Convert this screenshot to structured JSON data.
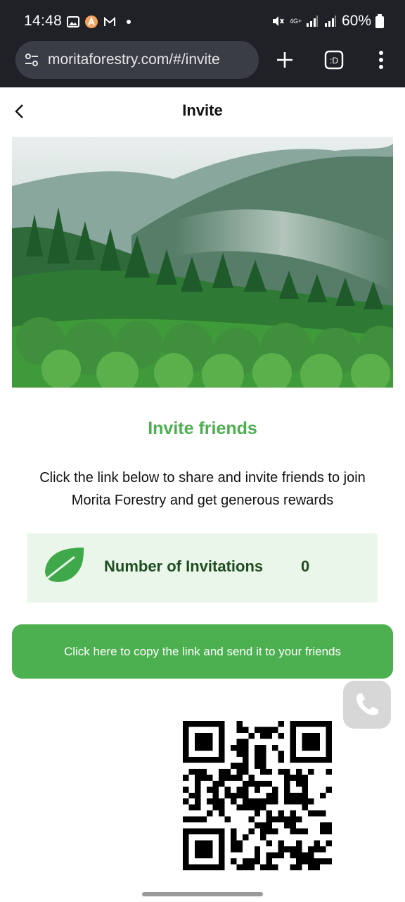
{
  "status_bar": {
    "time": "14:48",
    "battery": "60%",
    "network": "4G+"
  },
  "browser": {
    "url": "moritaforestry.com/#/invite",
    "tab_icon_text": ":D"
  },
  "header": {
    "title": "Invite"
  },
  "hero": {
    "subject": "misty forest mountains"
  },
  "invite": {
    "heading": "Invite friends",
    "description": "Click the link below to share and invite friends to join Morita Forestry and get generous rewards",
    "count_label": "Number of Invitations",
    "count_value": "0",
    "copy_button": "Click here to copy the link and send it to your friends"
  },
  "colors": {
    "accent_green": "#4caf50",
    "card_bg": "#eaf6ea",
    "dark_green_text": "#1f4d1f",
    "chrome_dark": "#1f2127"
  }
}
